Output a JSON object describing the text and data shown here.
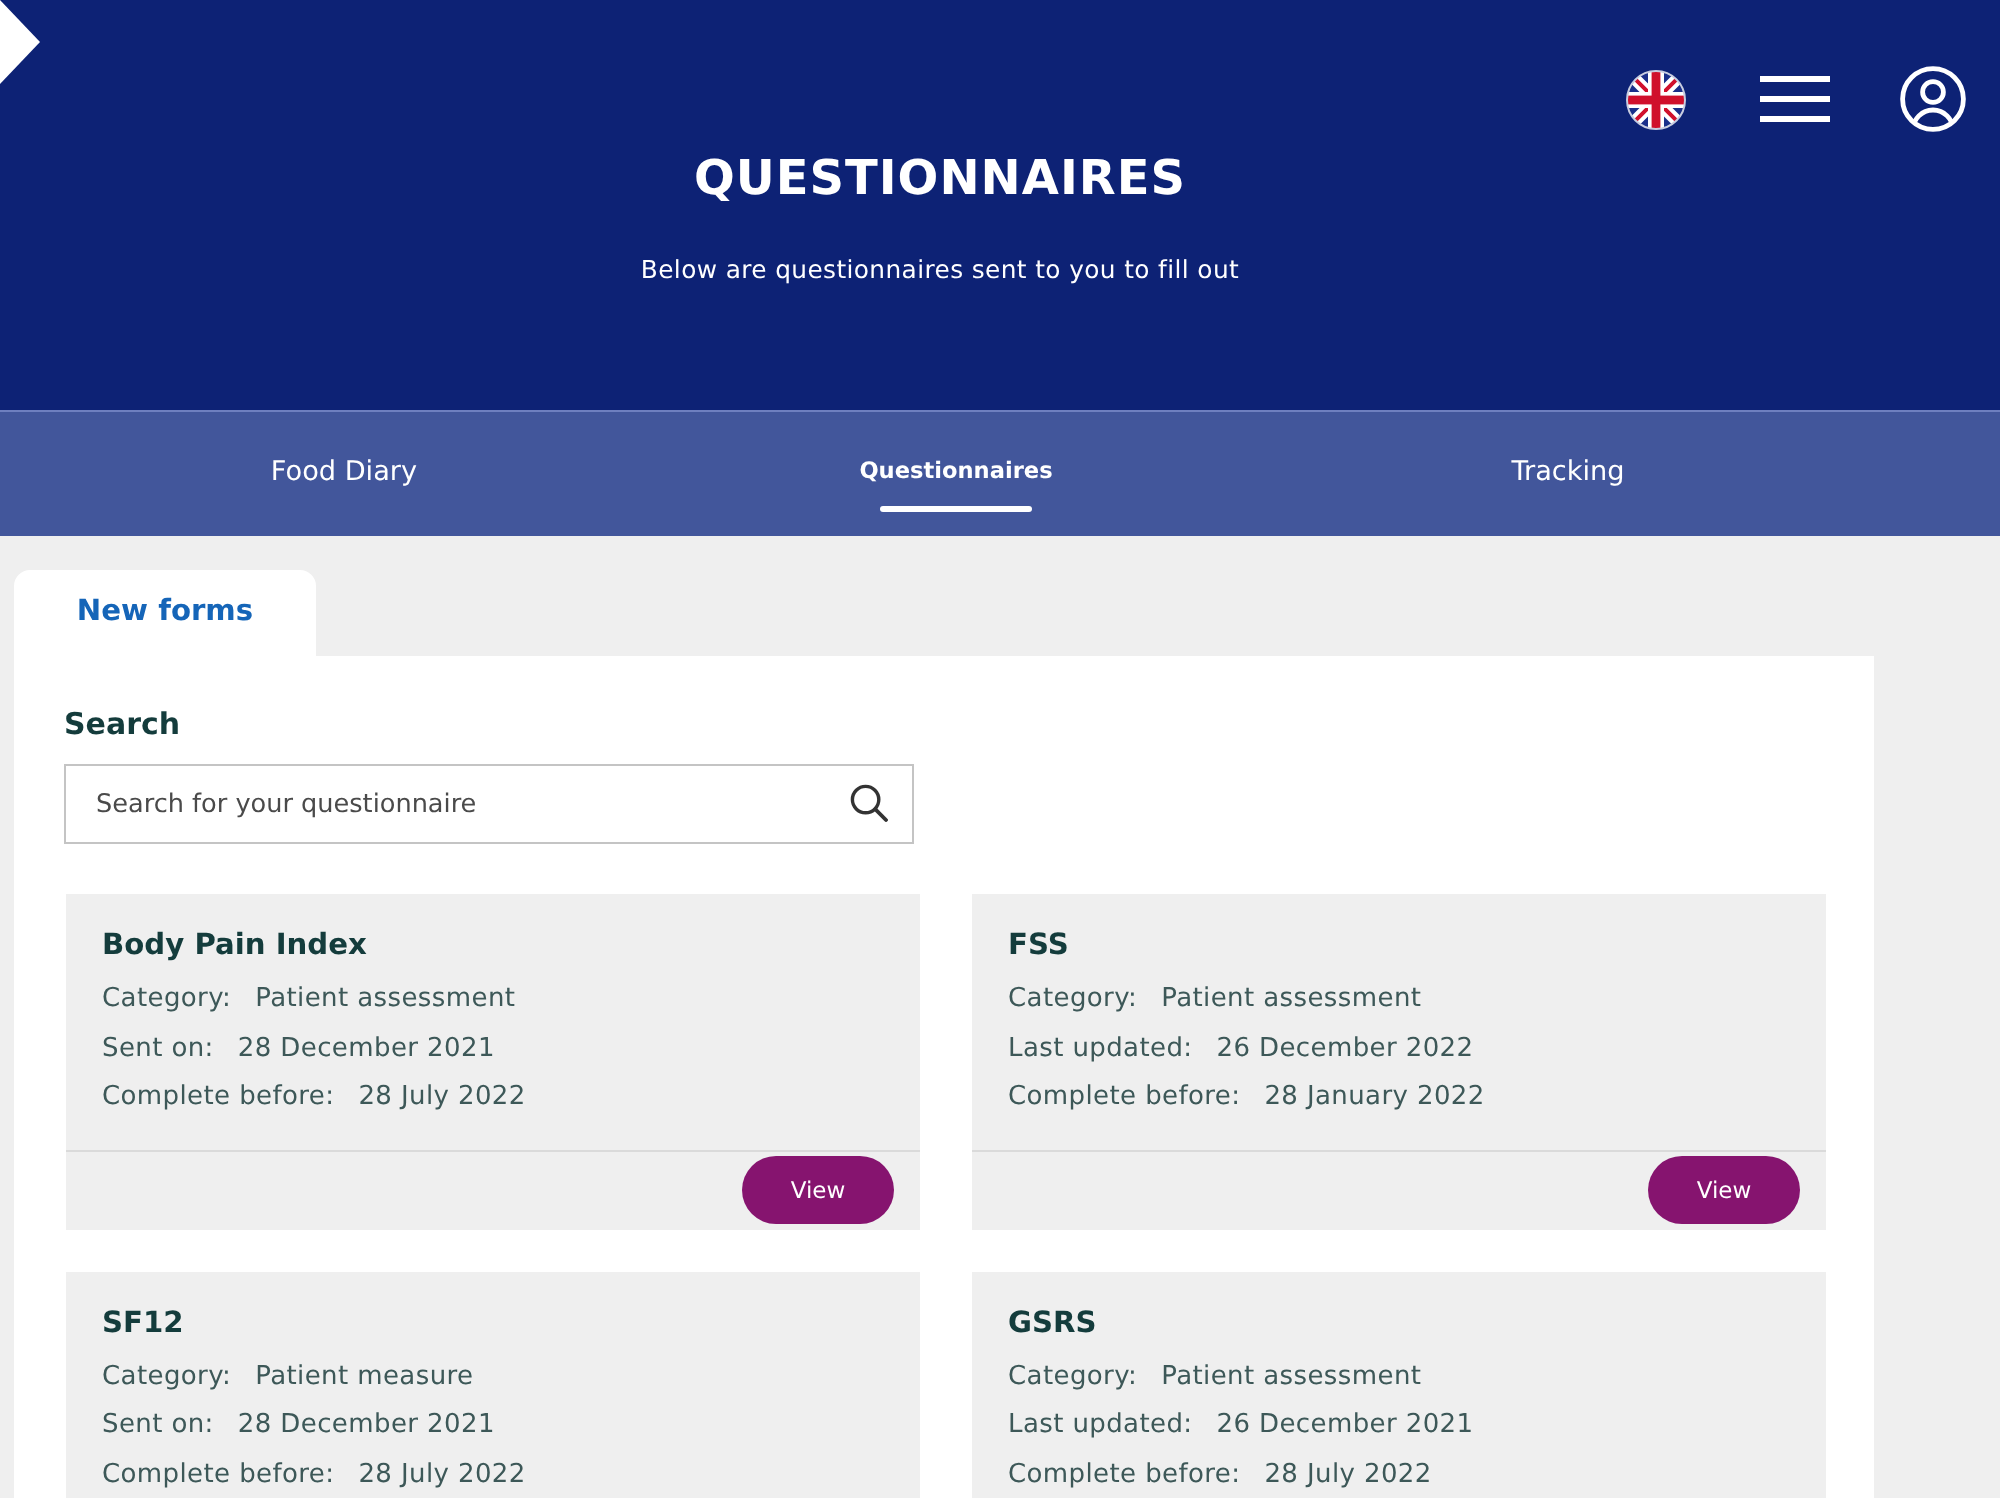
{
  "header": {
    "title": "QUESTIONNAIRES",
    "subtitle": "Below are questionnaires sent to you to fill out"
  },
  "nav_tabs": [
    {
      "label": "Food Diary",
      "selected": false
    },
    {
      "label": "Questionnaires",
      "selected": true
    },
    {
      "label": "Tracking",
      "selected": false
    }
  ],
  "form_tabs": [
    {
      "label": "New forms",
      "selected": true
    }
  ],
  "search": {
    "label": "Search",
    "placeholder": "Search for your questionnaire"
  },
  "cards": [
    {
      "title": "Body Pain Index",
      "fields": [
        {
          "label": "Category:",
          "value": "Patient assessment"
        },
        {
          "label": "Sent on:",
          "value": "28 December 2021"
        },
        {
          "label": "Complete before:",
          "value": "28 July 2022"
        }
      ],
      "button": "View"
    },
    {
      "title": "FSS",
      "fields": [
        {
          "label": "Category:",
          "value": "Patient assessment"
        },
        {
          "label": "Last updated:",
          "value": "26 December 2022"
        },
        {
          "label": "Complete before:",
          "value": "28 January 2022"
        }
      ],
      "button": "View"
    },
    {
      "title": "SF12",
      "fields": [
        {
          "label": "Category:",
          "value": "Patient measure"
        },
        {
          "label": "Sent on:",
          "value": "28 December 2021"
        },
        {
          "label": "Complete before:",
          "value": "28 July 2022"
        }
      ]
    },
    {
      "title": "GSRS",
      "fields": [
        {
          "label": "Category:",
          "value": "Patient assessment"
        },
        {
          "label": "Last updated:",
          "value": "26 December 2021"
        },
        {
          "label": "Complete before:",
          "value": "28 July 2022"
        }
      ]
    }
  ]
}
